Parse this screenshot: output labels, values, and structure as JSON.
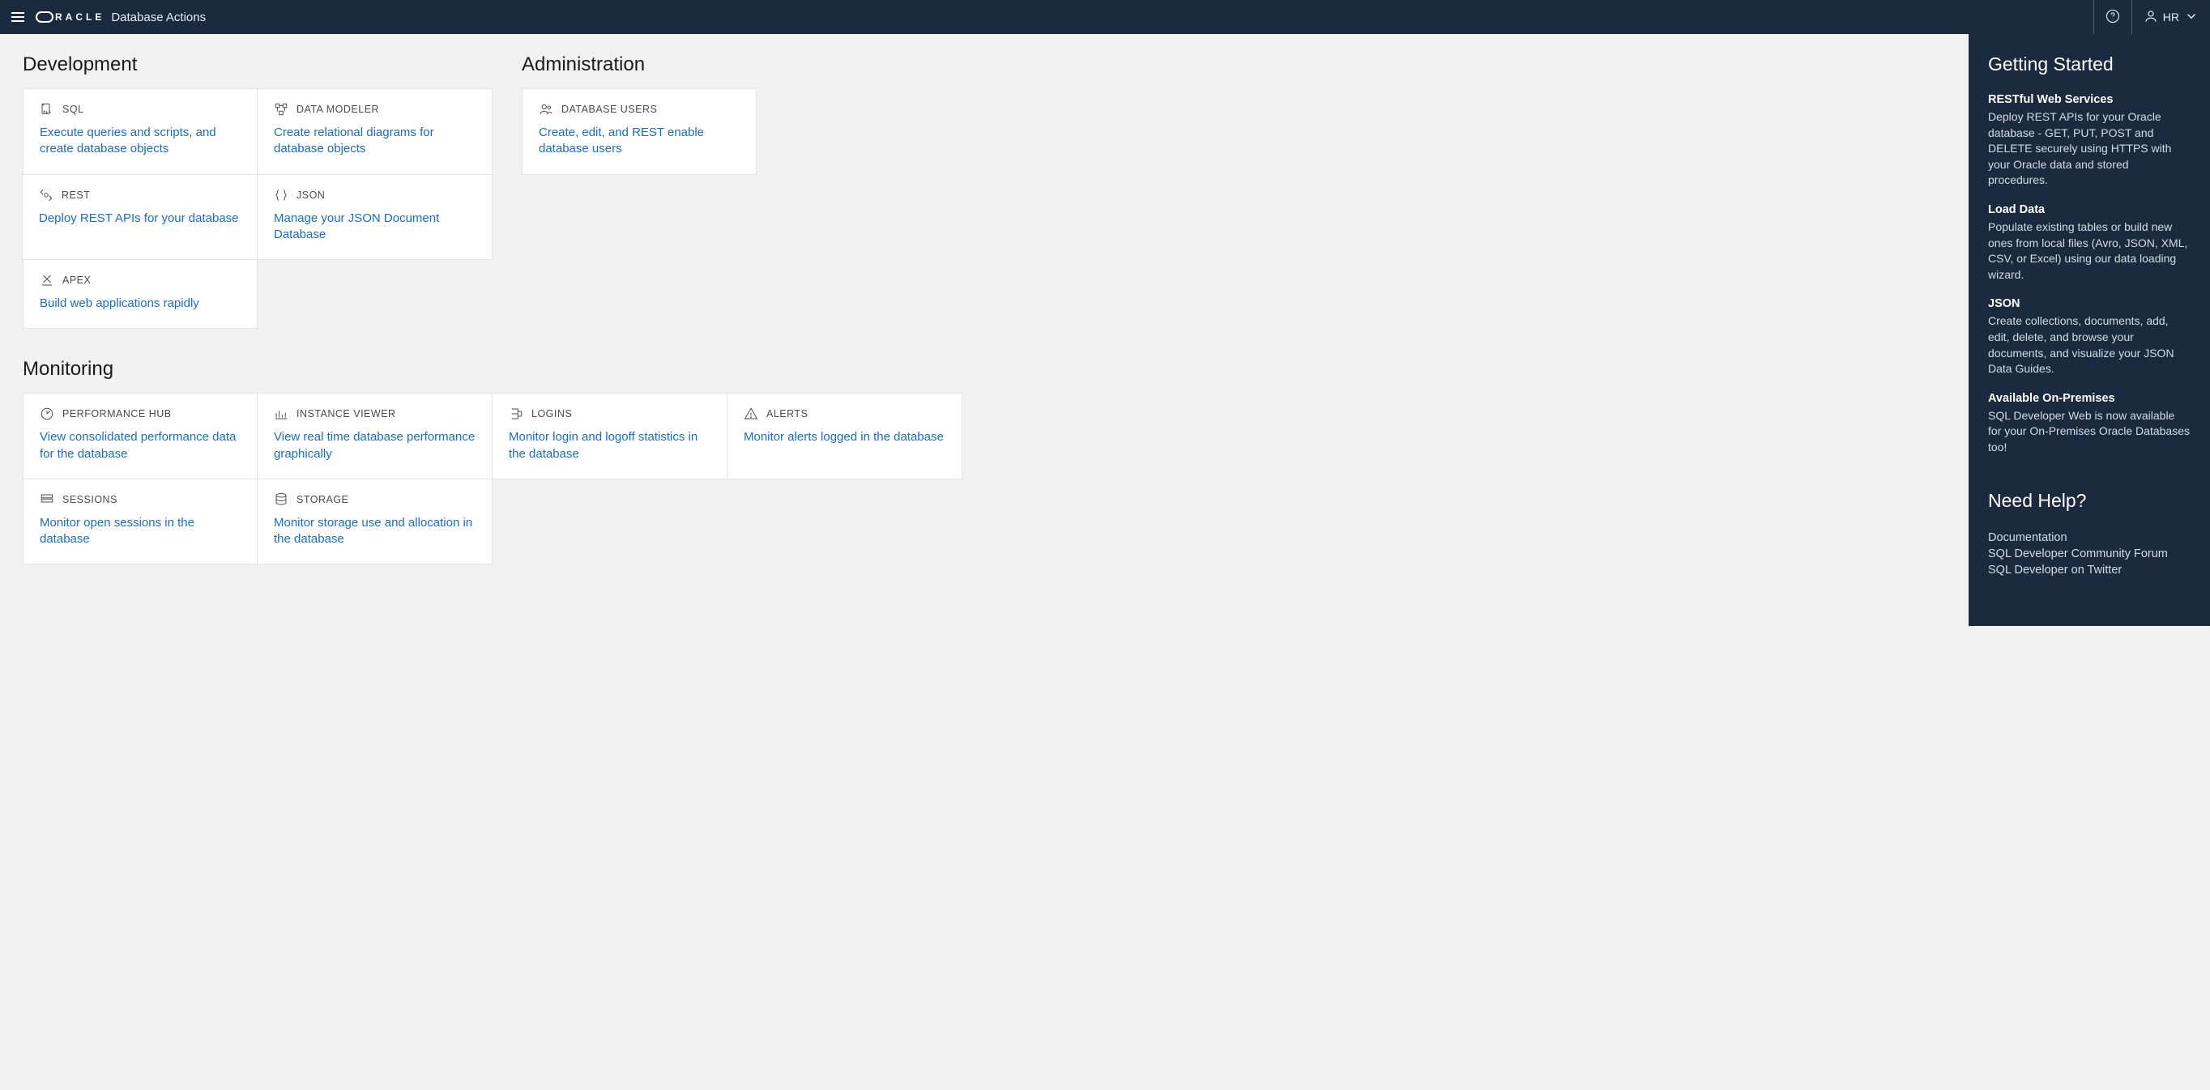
{
  "header": {
    "product_name": "Database Actions",
    "user_label": "HR"
  },
  "sections": {
    "development": {
      "title": "Development",
      "cards": [
        {
          "icon": "sql",
          "label": "SQL",
          "desc": "Execute queries and scripts, and create database objects"
        },
        {
          "icon": "data-modeler",
          "label": "DATA MODELER",
          "desc": "Create relational diagrams for database objects"
        },
        {
          "icon": "rest",
          "label": "REST",
          "desc": "Deploy REST APIs for your database"
        },
        {
          "icon": "json",
          "label": "JSON",
          "desc": "Manage your JSON Document Database"
        },
        {
          "icon": "apex",
          "label": "APEX",
          "desc": "Build web applications rapidly"
        }
      ]
    },
    "administration": {
      "title": "Administration",
      "cards": [
        {
          "icon": "users",
          "label": "DATABASE USERS",
          "desc": "Create, edit, and REST enable database users"
        }
      ]
    },
    "monitoring": {
      "title": "Monitoring",
      "cards": [
        {
          "icon": "perf",
          "label": "PERFORMANCE HUB",
          "desc": "View consolidated performance data for the database"
        },
        {
          "icon": "instance",
          "label": "INSTANCE VIEWER",
          "desc": "View real time database performance graphically"
        },
        {
          "icon": "logins",
          "label": "LOGINS",
          "desc": "Monitor login and logoff statistics in the database"
        },
        {
          "icon": "alerts",
          "label": "ALERTS",
          "desc": "Monitor alerts logged in the database"
        },
        {
          "icon": "sessions",
          "label": "SESSIONS",
          "desc": "Monitor open sessions in the database"
        },
        {
          "icon": "storage",
          "label": "STORAGE",
          "desc": "Monitor storage use and allocation in the database"
        }
      ]
    }
  },
  "sidebar": {
    "getting_started_title": "Getting Started",
    "items": [
      {
        "title": "RESTful Web Services",
        "text": "Deploy REST APIs for your Oracle database - GET, PUT, POST and DELETE securely using HTTPS with your Oracle data and stored procedures."
      },
      {
        "title": "Load Data",
        "text": "Populate existing tables or build new ones from local files (Avro, JSON, XML, CSV, or Excel) using our data loading wizard."
      },
      {
        "title": "JSON",
        "text": "Create collections, documents, add, edit, delete, and browse your documents, and visualize your JSON Data Guides."
      },
      {
        "title": "Available On-Premises",
        "text": "SQL Developer Web is now available for your On-Premises Oracle Databases too!"
      }
    ],
    "help_title": "Need Help?",
    "help_links": [
      "Documentation",
      "SQL Developer Community Forum",
      "SQL Developer on Twitter"
    ]
  }
}
